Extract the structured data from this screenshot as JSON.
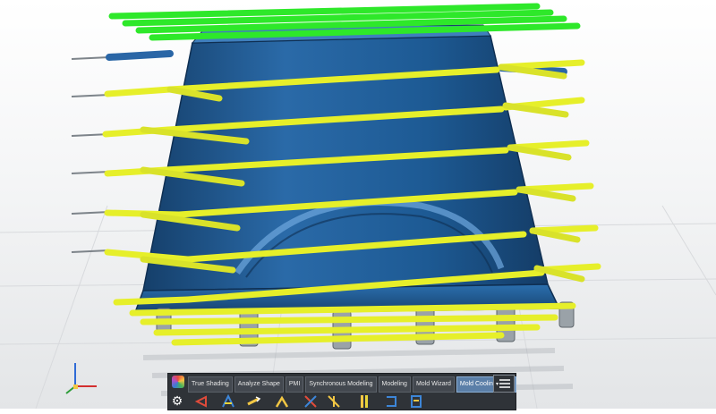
{
  "app": {
    "ribbon_tabs": [
      {
        "label": "True Shading",
        "active": false
      },
      {
        "label": "Analyze Shape",
        "active": false
      },
      {
        "label": "PMI",
        "active": false
      },
      {
        "label": "Synchronous Modeling",
        "active": false
      },
      {
        "label": "Modeling",
        "active": false
      },
      {
        "label": "Mold Wizard",
        "active": false
      },
      {
        "label": "Mold Cooling Tools",
        "active": true
      }
    ],
    "tools": [
      {
        "icon": "cooling-channel-icon"
      },
      {
        "icon": "channel-layout-icon"
      },
      {
        "icon": "extend-channel-icon"
      },
      {
        "icon": "connect-channel-icon"
      },
      {
        "icon": "cross-channel-icon"
      },
      {
        "icon": "baffle-icon"
      },
      {
        "icon": "channel-fittings-icon"
      },
      {
        "icon": "circuit-icon"
      }
    ],
    "colors": {
      "mold_body": "#1f5f9a",
      "cooling_lines": "#e6ef2a",
      "top_cooling_lines": "#2ee82a",
      "supports": "#9aa2a8"
    }
  }
}
